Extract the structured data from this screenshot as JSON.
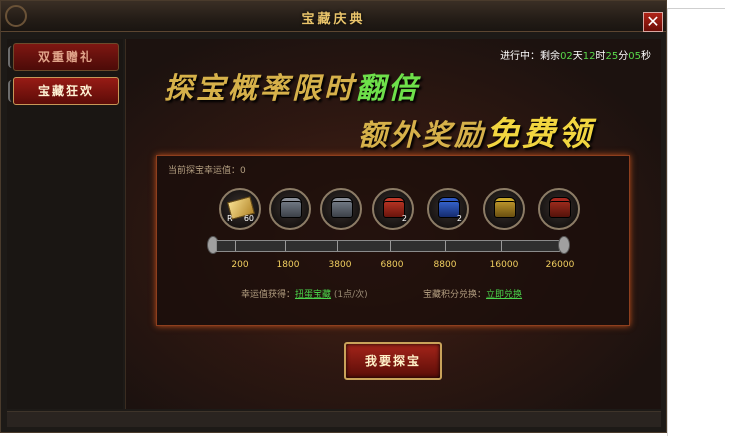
{
  "window": {
    "title": "宝藏庆典",
    "close_label": "✕"
  },
  "sidebar": {
    "items": [
      {
        "label": "双重赠礼",
        "active": false
      },
      {
        "label": "宝藏狂欢",
        "active": true
      }
    ]
  },
  "status": {
    "prefix": "进行中：剩余",
    "days": "02",
    "days_unit": "天",
    "hours": "12",
    "hours_unit": "时",
    "minutes": "25",
    "minutes_unit": "分",
    "seconds": "05",
    "seconds_unit": "秒"
  },
  "slogan": {
    "line1_text": "探宝概率限时",
    "line1_highlight": "翻倍",
    "line2_text": "额外奖励",
    "line2_highlight": "免费领"
  },
  "luck": {
    "label": "当前探宝幸运值：",
    "value": "0"
  },
  "rewards": [
    {
      "icon": "scroll-icon",
      "count_left": "R",
      "count": "60"
    },
    {
      "icon": "silver-chest-icon",
      "count": ""
    },
    {
      "icon": "silver-chest-icon",
      "count": ""
    },
    {
      "icon": "red-chest-icon",
      "count": "2"
    },
    {
      "icon": "blue-chest-icon",
      "count": "2"
    },
    {
      "icon": "gold-chest-icon",
      "count": ""
    },
    {
      "icon": "crimson-chest-icon",
      "count": ""
    }
  ],
  "milestones": [
    "200",
    "1800",
    "3800",
    "6800",
    "8800",
    "16000",
    "26000"
  ],
  "exchange": {
    "luck_gain_label": "幸运值获得：",
    "luck_gain_link": "扭蛋宝藏",
    "luck_gain_rate": "(1点/次)",
    "points_label": "宝藏积分兑换：",
    "points_link": "立即兑换"
  },
  "action": {
    "treasure_button": "我要探宝"
  },
  "colors": {
    "accent_gold": "#d6b14a",
    "highlight_green": "#6ee04a",
    "button_red": "#a4241a"
  }
}
